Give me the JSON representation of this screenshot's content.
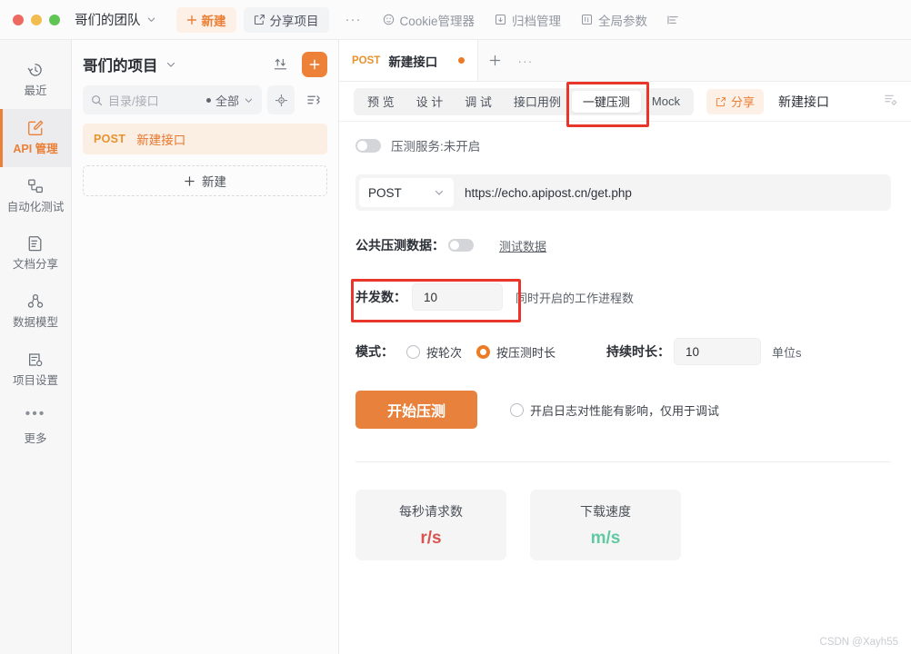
{
  "titlebar": {
    "team_name": "哥们的团队",
    "new_label": "新建",
    "share_project_label": "分享项目",
    "more_label": "···",
    "cookie_label": "Cookie管理器",
    "archive_label": "归档管理",
    "global_params_label": "全局参数"
  },
  "rail": {
    "items": [
      {
        "label": "最近",
        "icon": "history-icon",
        "active": false
      },
      {
        "label": "API 管理",
        "icon": "api-edit-icon",
        "active": true
      },
      {
        "label": "自动化测试",
        "icon": "automation-icon",
        "active": false
      },
      {
        "label": "文档分享",
        "icon": "document-share-icon",
        "active": false
      },
      {
        "label": "数据模型",
        "icon": "data-model-icon",
        "active": false
      },
      {
        "label": "项目设置",
        "icon": "project-settings-icon",
        "active": false
      },
      {
        "label": "更多",
        "icon": "more-dots-icon",
        "active": false
      }
    ]
  },
  "project": {
    "title": "哥们的项目",
    "search_placeholder": "目录/接口",
    "scope_label": "全部",
    "api_item": {
      "method": "POST",
      "name": "新建接口"
    },
    "new_button_label": "新建"
  },
  "doc_tab": {
    "method": "POST",
    "name": "新建接口"
  },
  "tabs": [
    {
      "label": "预 览",
      "active": false
    },
    {
      "label": "设 计",
      "active": false
    },
    {
      "label": "调 试",
      "active": false
    },
    {
      "label": "接口用例",
      "active": false
    },
    {
      "label": "一键压测",
      "active": true
    },
    {
      "label": "Mock",
      "active": false
    }
  ],
  "toolbar2": {
    "share_label": "分享",
    "interface_name": "新建接口"
  },
  "stress": {
    "service_toggle_label": "压测服务:未开启",
    "service_toggle_on": false,
    "method": "POST",
    "url": "https://echo.apipost.cn/get.php",
    "public_data_label": "公共压测数据：",
    "public_data_on": false,
    "test_data_link": "测试数据",
    "concurrency_label": "并发数：",
    "concurrency_value": "10",
    "concurrency_hint": "同时开启的工作进程数",
    "mode_label": "模式：",
    "mode_options": [
      {
        "label": "按轮次",
        "selected": false
      },
      {
        "label": "按压测时长",
        "selected": true
      }
    ],
    "duration_label": "持续时长：",
    "duration_value": "10",
    "duration_unit": "单位s",
    "start_button_label": "开始压测",
    "log_checkbox_label": "开启日志对性能有影响，仅用于调试",
    "log_checkbox_on": false
  },
  "stats": [
    {
      "title": "每秒请求数",
      "value": "r/s",
      "color": "#d9534f"
    },
    {
      "title": "下载速度",
      "value": "m/s",
      "color": "#5fc9a1"
    }
  ],
  "watermark": "CSDN @Xayh55",
  "colors": {
    "accent": "#ed8138",
    "annotation": "#e8372a"
  }
}
